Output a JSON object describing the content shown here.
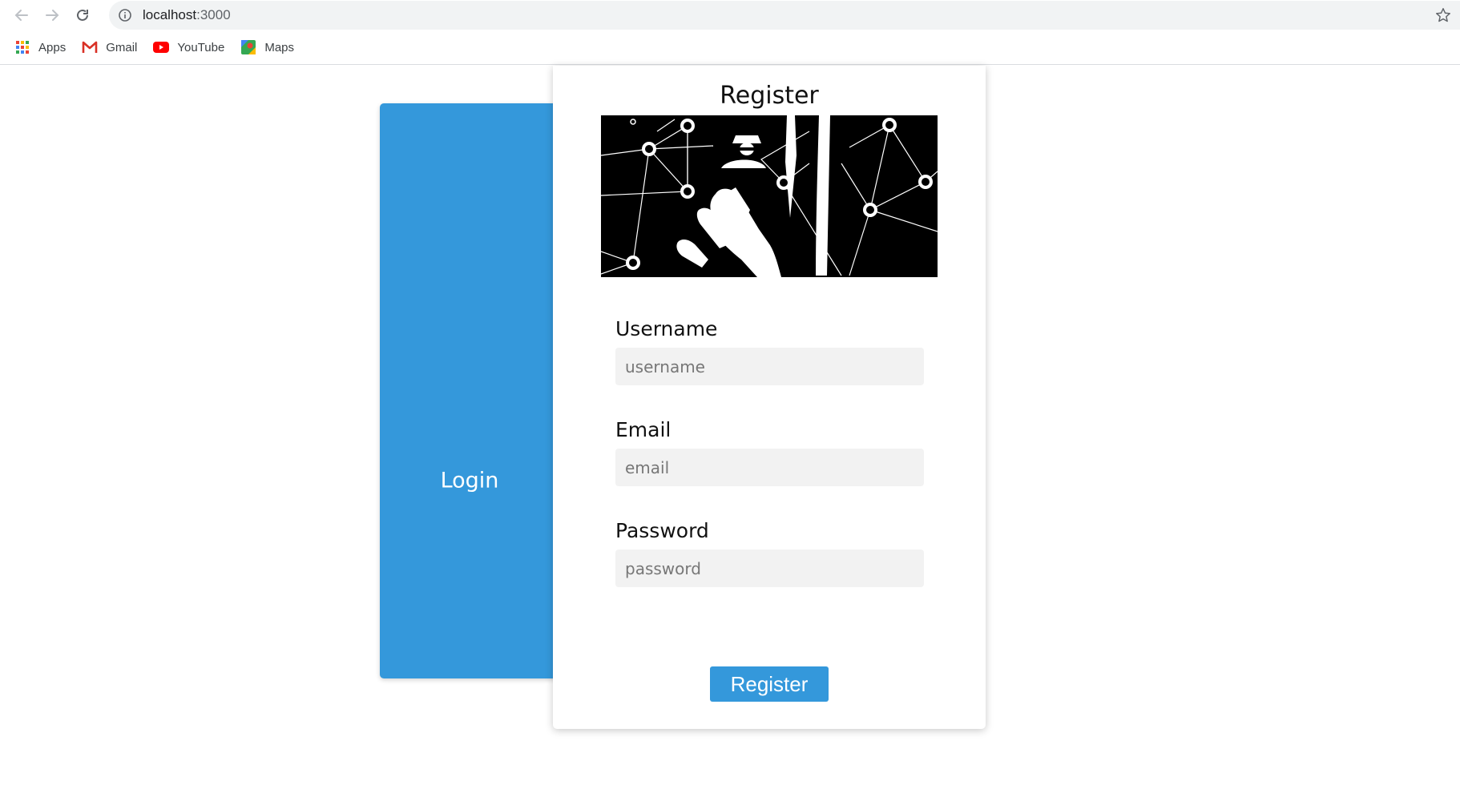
{
  "browser": {
    "url_host": "localhost",
    "url_port": ":3000",
    "bookmarks": [
      {
        "label": "Apps",
        "icon": "apps-grid-icon"
      },
      {
        "label": "Gmail",
        "icon": "gmail-icon"
      },
      {
        "label": "YouTube",
        "icon": "youtube-icon"
      },
      {
        "label": "Maps",
        "icon": "maps-icon"
      }
    ]
  },
  "login": {
    "label": "Login",
    "color": "#3498db"
  },
  "register": {
    "title": "Register",
    "image": "hacker-network-illustration",
    "fields": [
      {
        "label": "Username",
        "placeholder": "username"
      },
      {
        "label": "Email",
        "placeholder": "email"
      },
      {
        "label": "Password",
        "placeholder": "password"
      }
    ],
    "button_label": "Register",
    "button_color": "#3498db"
  }
}
